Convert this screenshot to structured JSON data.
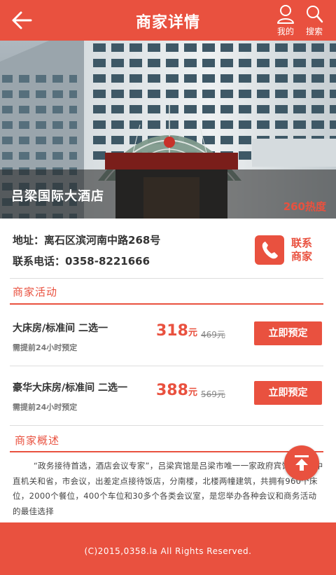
{
  "header": {
    "title": "商家详情",
    "mine_label": "我的",
    "search_label": "搜索",
    "icons": {
      "back": "back-arrow-icon",
      "mine": "user-icon",
      "search": "search-icon"
    },
    "bg_color": "#e9513f"
  },
  "hero": {
    "name": "吕梁国际大酒店",
    "heat": "260热度"
  },
  "info": {
    "address": "地址：离石区滨河南中路268号",
    "phone": "联系电话：0358-8221666",
    "contact_label": "联系商家"
  },
  "activities": {
    "title": "商家活动",
    "deals": [
      {
        "name": "大床房/标准间 二选一",
        "note": "需提前24小时预定",
        "price": "318",
        "unit": "元",
        "original": "469元",
        "book_label": "立即预定"
      },
      {
        "name": "豪华大床房/标准间 二选一",
        "note": "需提前24小时预定",
        "price": "388",
        "unit": "元",
        "original": "569元",
        "book_label": "立即预定"
      }
    ]
  },
  "overview": {
    "title": "商家概述",
    "text": "“政务接待首选，酒店会议专家”，吕梁宾馆是吕梁市唯一一家政府宾馆，也是中直机关和省，市会议，出差定点接待饭店，分南楼，北楼两幢建筑，共拥有960个床位，2000个餐位，400个车位和30多个各类会议室，是您举办各种会议和商务活动的最佳选择"
  },
  "footer": {
    "copyright": "(C)2015,0358.la All Rights Reserved."
  },
  "accent_color": "#e9513f"
}
